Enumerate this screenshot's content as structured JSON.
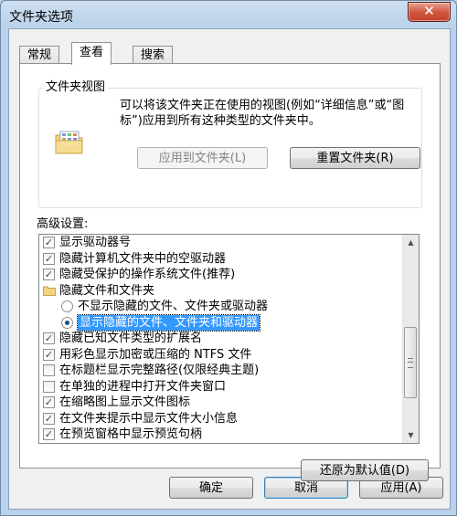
{
  "window": {
    "title": "文件夹选项",
    "close_glyph": "✕"
  },
  "tabs": [
    {
      "label": "常规",
      "active": false
    },
    {
      "label": "查看",
      "active": true
    },
    {
      "label": "搜索",
      "active": false
    }
  ],
  "folder_views": {
    "legend": "文件夹视图",
    "icon": "folder-view-icon",
    "description": "可以将该文件夹正在使用的视图(例如“详细信息”或“图标”)应用到所有这种类型的文件夹中。",
    "apply_button": "应用到文件夹(L)",
    "reset_button": "重置文件夹(R)"
  },
  "advanced": {
    "label": "高级设置:",
    "items": [
      {
        "type": "checkbox",
        "checked": true,
        "label": "显示驱动器号"
      },
      {
        "type": "checkbox",
        "checked": true,
        "label": "隐藏计算机文件夹中的空驱动器"
      },
      {
        "type": "checkbox",
        "checked": true,
        "label": "隐藏受保护的操作系统文件(推荐)"
      },
      {
        "type": "folder",
        "label": "隐藏文件和文件夹"
      },
      {
        "type": "radio",
        "checked": false,
        "label": "不显示隐藏的文件、文件夹或驱动器"
      },
      {
        "type": "radio",
        "checked": true,
        "label": "显示隐藏的文件、文件夹和驱动器",
        "selected": true
      },
      {
        "type": "checkbox",
        "checked": true,
        "label": "隐藏已知文件类型的扩展名"
      },
      {
        "type": "checkbox",
        "checked": true,
        "label": "用彩色显示加密或压缩的 NTFS 文件"
      },
      {
        "type": "checkbox",
        "checked": false,
        "label": "在标题栏显示完整路径(仅限经典主题)"
      },
      {
        "type": "checkbox",
        "checked": false,
        "label": "在单独的进程中打开文件夹窗口"
      },
      {
        "type": "checkbox",
        "checked": true,
        "label": "在缩略图上显示文件图标"
      },
      {
        "type": "checkbox",
        "checked": true,
        "label": "在文件夹提示中显示文件大小信息"
      },
      {
        "type": "checkbox",
        "checked": true,
        "label": "在预览窗格中显示预览句柄"
      }
    ],
    "restore_button": "还原为默认值(D)",
    "scroll_up_glyph": "▲",
    "scroll_down_glyph": "▼"
  },
  "footer": {
    "ok": "确定",
    "cancel": "取消",
    "apply": "应用(A)"
  },
  "colors": {
    "selection": "#3399ff",
    "title_bar": "#b9d1ea",
    "close_button": "#c44027"
  }
}
